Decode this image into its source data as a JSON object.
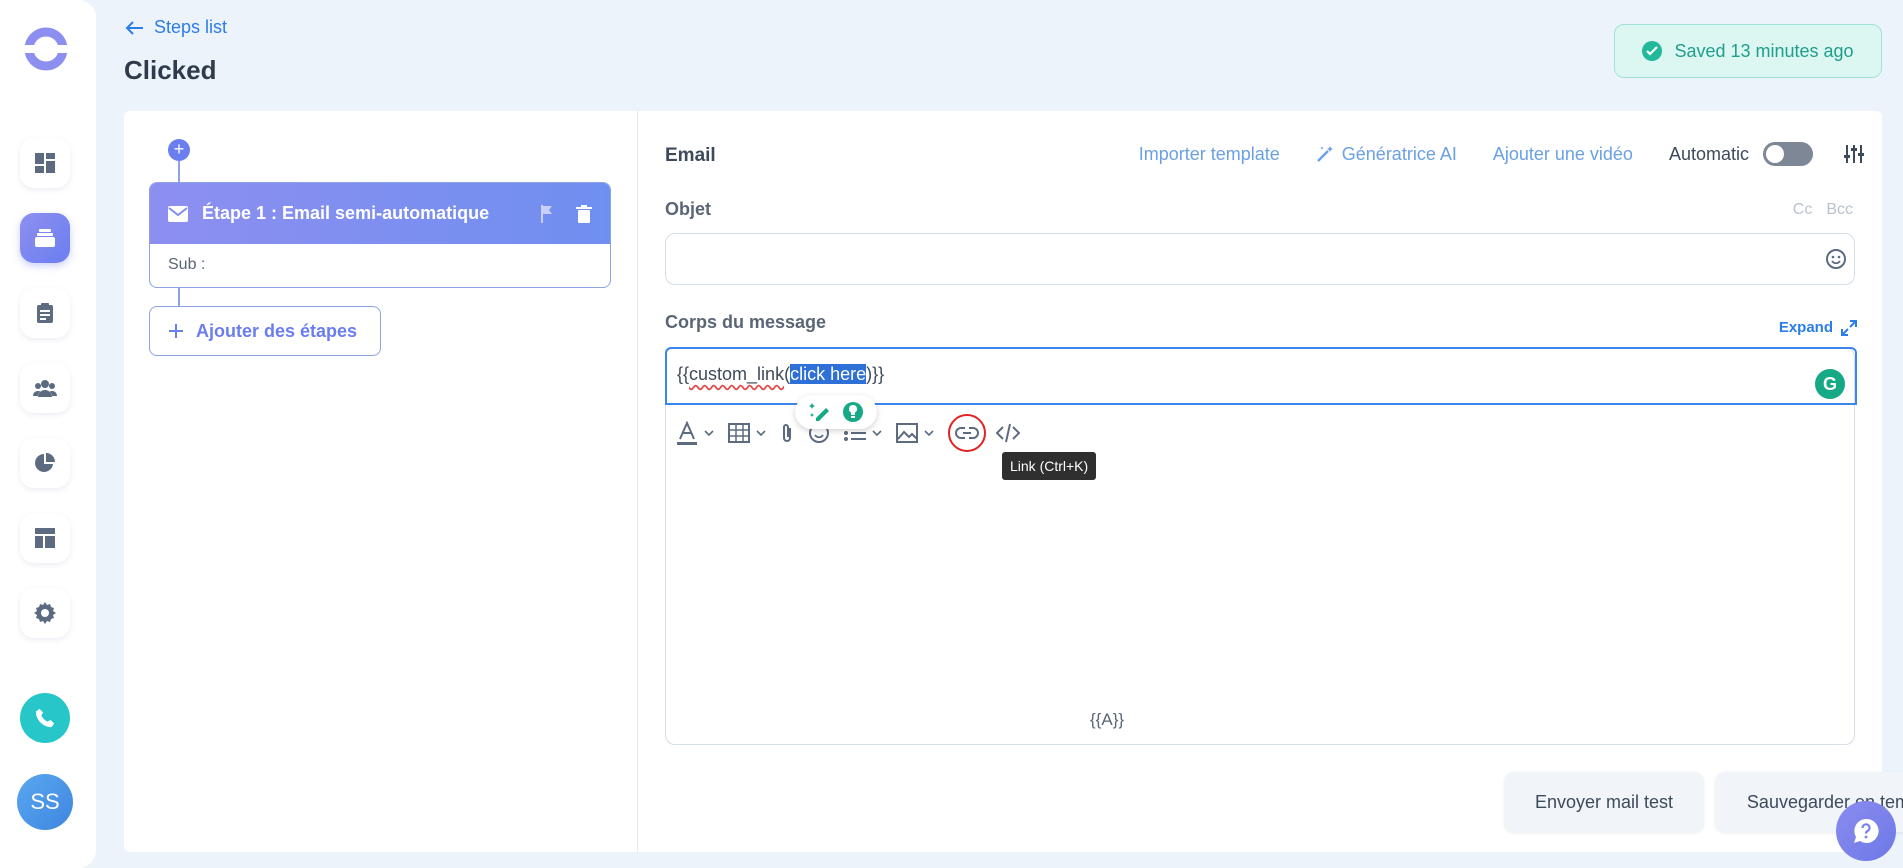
{
  "header": {
    "back_label": "Steps list",
    "page_title": "Clicked",
    "saved_status": "Saved 13 minutes ago"
  },
  "sidebar": {
    "items": [
      {
        "icon": "dashboard-icon",
        "active": false
      },
      {
        "icon": "sequences-icon",
        "active": true
      },
      {
        "icon": "clipboard-icon",
        "active": false
      },
      {
        "icon": "contacts-icon",
        "active": false
      },
      {
        "icon": "pie-chart-icon",
        "active": false
      },
      {
        "icon": "layout-icon",
        "active": false
      },
      {
        "icon": "gear-icon",
        "active": false
      }
    ],
    "avatar_initials": "SS"
  },
  "steps": {
    "step1_title": "Étape 1 : Email semi-automatique",
    "step1_sub": "Sub :",
    "add_steps_label": "Ajouter des étapes"
  },
  "email": {
    "section_label": "Email",
    "import_template": "Importer template",
    "ai_generator": "Génératrice AI",
    "add_video": "Ajouter une vidéo",
    "automatic_label": "Automatic",
    "automatic_on": false,
    "subject_label": "Objet",
    "subject_value": "",
    "cc_label": "Cc",
    "bcc_label": "Bcc",
    "body_label": "Corps du message",
    "expand_label": "Expand",
    "body_prefix": "{{",
    "body_func": "custom_link",
    "body_paren": "(",
    "body_selected": "click here",
    "body_suffix": ")}}",
    "link_tooltip": "Link (Ctrl+K)",
    "variable_placeholder": "{{A}}",
    "send_test_label": "Envoyer mail test",
    "save_template_label": "Sauvegarder en template"
  },
  "colors": {
    "accent": "#6b7ef0",
    "link_blue": "#2b7de9",
    "saved_green": "#1f9e8a",
    "highlight": "#e02424"
  }
}
